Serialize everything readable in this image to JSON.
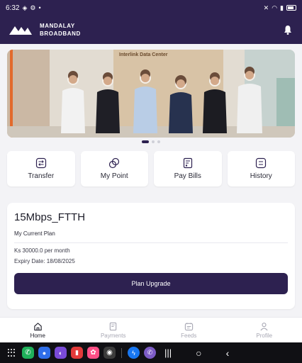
{
  "status": {
    "time": "6:32",
    "right_text": ""
  },
  "brand": {
    "line1": "MANDALAY",
    "line2": "BROADBAND"
  },
  "banner": {
    "sign_title": "Interlink Data Center"
  },
  "carousel": {
    "count": 3,
    "active": 0
  },
  "actions": [
    {
      "label": "Transfer",
      "icon": "transfer-icon"
    },
    {
      "label": "My Point",
      "icon": "point-icon"
    },
    {
      "label": "Pay Bills",
      "icon": "pay-bills-icon"
    },
    {
      "label": "History",
      "icon": "history-icon"
    }
  ],
  "plan": {
    "name": "15Mbps_FTTH",
    "subtitle": "My Current Plan",
    "price": "Ks 30000.0 per month",
    "expiry": "Expiry Date: 18/08/2025",
    "button": "Plan Upgrade"
  },
  "nav": [
    {
      "label": "Home",
      "icon": "home-icon",
      "active": true
    },
    {
      "label": "Payments",
      "icon": "payments-icon",
      "active": false
    },
    {
      "label": "Feeds",
      "icon": "feeds-icon",
      "active": false
    },
    {
      "label": "Profile",
      "icon": "profile-icon",
      "active": false
    }
  ],
  "colors": {
    "primary": "#2d2150",
    "background": "#f3f3f6",
    "card": "#ffffff"
  }
}
